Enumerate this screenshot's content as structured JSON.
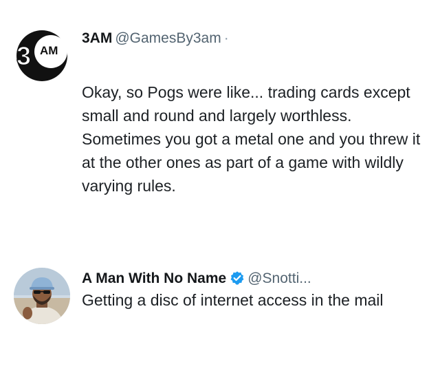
{
  "tweets": [
    {
      "avatar_icon": "3am-logo-icon",
      "avatar_text": "3",
      "avatar_small_text": "AM",
      "display_name": "3AM",
      "handle": "@GamesBy3am",
      "separator": "·",
      "text": "Okay, so Pogs were like... trading cards except small and round and largely worthless. Sometimes you got a metal one and you threw it at the other ones as part of a game with wildly varying rules."
    },
    {
      "avatar_icon": "user-photo-icon",
      "display_name": "A Man With No Name",
      "verified_icon": "verified-badge-icon",
      "handle": "@Snotti...",
      "text": "Getting a disc of internet access in the mail"
    }
  ],
  "colors": {
    "text": "#14171a",
    "handle": "#536471",
    "verified": "#1d9bf0"
  }
}
